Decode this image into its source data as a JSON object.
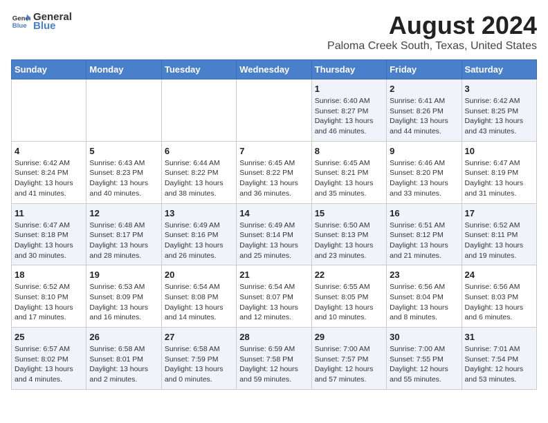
{
  "header": {
    "logo_general": "General",
    "logo_blue": "Blue",
    "main_title": "August 2024",
    "subtitle": "Paloma Creek South, Texas, United States"
  },
  "days_of_week": [
    "Sunday",
    "Monday",
    "Tuesday",
    "Wednesday",
    "Thursday",
    "Friday",
    "Saturday"
  ],
  "weeks": [
    [
      {
        "day": "",
        "info": ""
      },
      {
        "day": "",
        "info": ""
      },
      {
        "day": "",
        "info": ""
      },
      {
        "day": "",
        "info": ""
      },
      {
        "day": "1",
        "info": "Sunrise: 6:40 AM\nSunset: 8:27 PM\nDaylight: 13 hours\nand 46 minutes."
      },
      {
        "day": "2",
        "info": "Sunrise: 6:41 AM\nSunset: 8:26 PM\nDaylight: 13 hours\nand 44 minutes."
      },
      {
        "day": "3",
        "info": "Sunrise: 6:42 AM\nSunset: 8:25 PM\nDaylight: 13 hours\nand 43 minutes."
      }
    ],
    [
      {
        "day": "4",
        "info": "Sunrise: 6:42 AM\nSunset: 8:24 PM\nDaylight: 13 hours\nand 41 minutes."
      },
      {
        "day": "5",
        "info": "Sunrise: 6:43 AM\nSunset: 8:23 PM\nDaylight: 13 hours\nand 40 minutes."
      },
      {
        "day": "6",
        "info": "Sunrise: 6:44 AM\nSunset: 8:22 PM\nDaylight: 13 hours\nand 38 minutes."
      },
      {
        "day": "7",
        "info": "Sunrise: 6:45 AM\nSunset: 8:22 PM\nDaylight: 13 hours\nand 36 minutes."
      },
      {
        "day": "8",
        "info": "Sunrise: 6:45 AM\nSunset: 8:21 PM\nDaylight: 13 hours\nand 35 minutes."
      },
      {
        "day": "9",
        "info": "Sunrise: 6:46 AM\nSunset: 8:20 PM\nDaylight: 13 hours\nand 33 minutes."
      },
      {
        "day": "10",
        "info": "Sunrise: 6:47 AM\nSunset: 8:19 PM\nDaylight: 13 hours\nand 31 minutes."
      }
    ],
    [
      {
        "day": "11",
        "info": "Sunrise: 6:47 AM\nSunset: 8:18 PM\nDaylight: 13 hours\nand 30 minutes."
      },
      {
        "day": "12",
        "info": "Sunrise: 6:48 AM\nSunset: 8:17 PM\nDaylight: 13 hours\nand 28 minutes."
      },
      {
        "day": "13",
        "info": "Sunrise: 6:49 AM\nSunset: 8:16 PM\nDaylight: 13 hours\nand 26 minutes."
      },
      {
        "day": "14",
        "info": "Sunrise: 6:49 AM\nSunset: 8:14 PM\nDaylight: 13 hours\nand 25 minutes."
      },
      {
        "day": "15",
        "info": "Sunrise: 6:50 AM\nSunset: 8:13 PM\nDaylight: 13 hours\nand 23 minutes."
      },
      {
        "day": "16",
        "info": "Sunrise: 6:51 AM\nSunset: 8:12 PM\nDaylight: 13 hours\nand 21 minutes."
      },
      {
        "day": "17",
        "info": "Sunrise: 6:52 AM\nSunset: 8:11 PM\nDaylight: 13 hours\nand 19 minutes."
      }
    ],
    [
      {
        "day": "18",
        "info": "Sunrise: 6:52 AM\nSunset: 8:10 PM\nDaylight: 13 hours\nand 17 minutes."
      },
      {
        "day": "19",
        "info": "Sunrise: 6:53 AM\nSunset: 8:09 PM\nDaylight: 13 hours\nand 16 minutes."
      },
      {
        "day": "20",
        "info": "Sunrise: 6:54 AM\nSunset: 8:08 PM\nDaylight: 13 hours\nand 14 minutes."
      },
      {
        "day": "21",
        "info": "Sunrise: 6:54 AM\nSunset: 8:07 PM\nDaylight: 13 hours\nand 12 minutes."
      },
      {
        "day": "22",
        "info": "Sunrise: 6:55 AM\nSunset: 8:05 PM\nDaylight: 13 hours\nand 10 minutes."
      },
      {
        "day": "23",
        "info": "Sunrise: 6:56 AM\nSunset: 8:04 PM\nDaylight: 13 hours\nand 8 minutes."
      },
      {
        "day": "24",
        "info": "Sunrise: 6:56 AM\nSunset: 8:03 PM\nDaylight: 13 hours\nand 6 minutes."
      }
    ],
    [
      {
        "day": "25",
        "info": "Sunrise: 6:57 AM\nSunset: 8:02 PM\nDaylight: 13 hours\nand 4 minutes."
      },
      {
        "day": "26",
        "info": "Sunrise: 6:58 AM\nSunset: 8:01 PM\nDaylight: 13 hours\nand 2 minutes."
      },
      {
        "day": "27",
        "info": "Sunrise: 6:58 AM\nSunset: 7:59 PM\nDaylight: 13 hours\nand 0 minutes."
      },
      {
        "day": "28",
        "info": "Sunrise: 6:59 AM\nSunset: 7:58 PM\nDaylight: 12 hours\nand 59 minutes."
      },
      {
        "day": "29",
        "info": "Sunrise: 7:00 AM\nSunset: 7:57 PM\nDaylight: 12 hours\nand 57 minutes."
      },
      {
        "day": "30",
        "info": "Sunrise: 7:00 AM\nSunset: 7:55 PM\nDaylight: 12 hours\nand 55 minutes."
      },
      {
        "day": "31",
        "info": "Sunrise: 7:01 AM\nSunset: 7:54 PM\nDaylight: 12 hours\nand 53 minutes."
      }
    ]
  ]
}
